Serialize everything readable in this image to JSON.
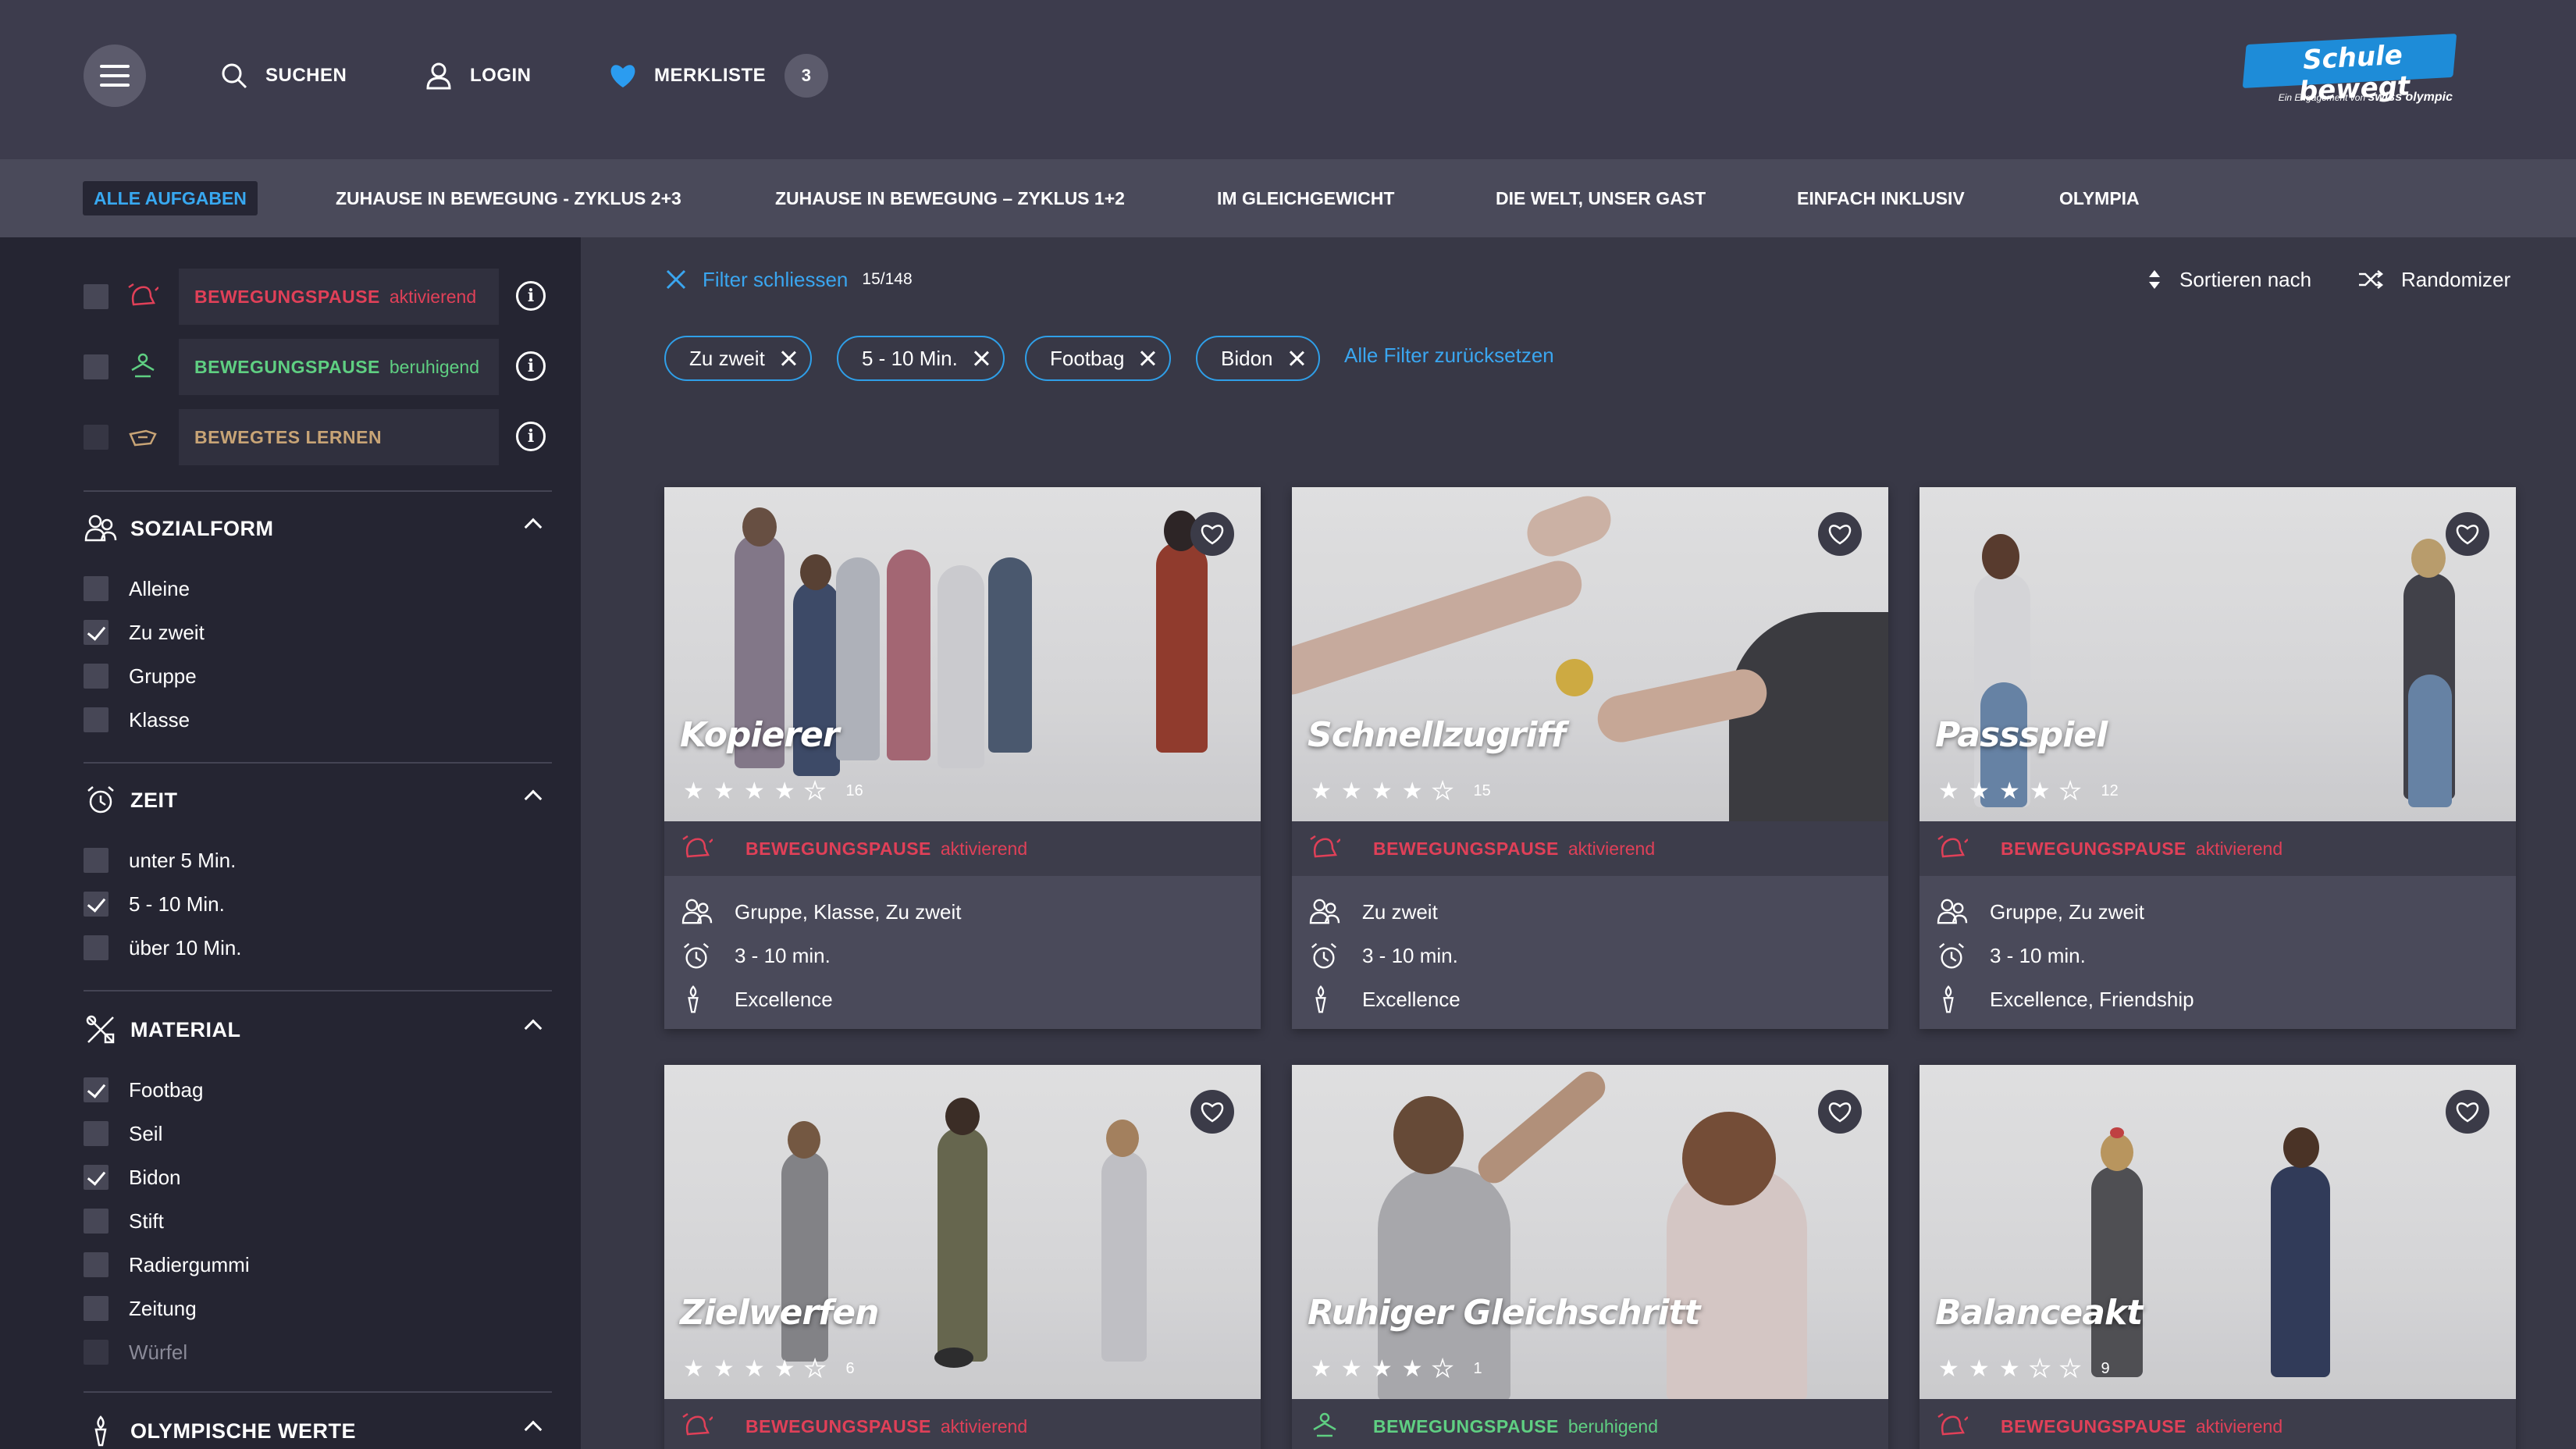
{
  "header": {
    "search_label": "SUCHEN",
    "login_label": "LOGIN",
    "watchlist_label": "MERKLISTE",
    "watchlist_count": "3",
    "logo_main": "Schule bewegt",
    "logo_sub_prefix": "Ein Engagement von",
    "logo_sub_brand": "swiss olympic"
  },
  "categories": [
    "ALLE AUFGABEN",
    "ZUHAUSE IN BEWEGUNG - ZYKLUS 2+3",
    "ZUHAUSE IN BEWEGUNG – ZYKLUS 1+2",
    "IM GLEICHGEWICHT",
    "DIE WELT, UNSER GAST",
    "EINFACH INKLUSIV",
    "OLYMPIA"
  ],
  "sidebar": {
    "types": [
      {
        "main": "BEWEGUNGSPAUSE",
        "sub": "aktivierend",
        "color": "#e04058"
      },
      {
        "main": "BEWEGUNGSPAUSE",
        "sub": "beruhigend",
        "color": "#5fcf82"
      },
      {
        "main": "BEWEGTES LERNEN",
        "sub": "",
        "color": "#c8a476"
      }
    ],
    "sozialform": {
      "title": "SOZIALFORM",
      "options": [
        {
          "label": "Alleine",
          "checked": false
        },
        {
          "label": "Zu zweit",
          "checked": true
        },
        {
          "label": "Gruppe",
          "checked": false
        },
        {
          "label": "Klasse",
          "checked": false
        }
      ]
    },
    "zeit": {
      "title": "ZEIT",
      "options": [
        {
          "label": "unter 5 Min.",
          "checked": false
        },
        {
          "label": "5 - 10 Min.",
          "checked": true
        },
        {
          "label": "über 10 Min.",
          "checked": false
        }
      ]
    },
    "material": {
      "title": "MATERIAL",
      "options": [
        {
          "label": "Footbag",
          "checked": true
        },
        {
          "label": "Seil",
          "checked": false
        },
        {
          "label": "Bidon",
          "checked": true
        },
        {
          "label": "Stift",
          "checked": false
        },
        {
          "label": "Radiergummi",
          "checked": false
        },
        {
          "label": "Zeitung",
          "checked": false
        },
        {
          "label": "Würfel",
          "checked": false
        }
      ]
    },
    "olympic_values": {
      "title": "OLYMPISCHE WERTE"
    }
  },
  "filterbar": {
    "close_label": "Filter schliessen",
    "count": "15/148",
    "sort_label": "Sortieren nach",
    "random_label": "Randomizer",
    "chips": [
      "Zu zweit",
      "5 - 10 Min.",
      "Footbag",
      "Bidon"
    ],
    "reset_label": "Alle Filter zurücksetzen"
  },
  "cards": [
    {
      "title": "Kopierer",
      "rating": 4,
      "votes": "16",
      "type_main": "BEWEGUNGSPAUSE",
      "type_sub": "aktivierend",
      "type_color": "#e04058",
      "social": "Gruppe, Klasse, Zu zweit",
      "time": "3 - 10 min.",
      "values": "Excellence"
    },
    {
      "title": "Schnellzugriff",
      "rating": 4,
      "votes": "15",
      "type_main": "BEWEGUNGSPAUSE",
      "type_sub": "aktivierend",
      "type_color": "#e04058",
      "social": "Zu zweit",
      "time": "3 - 10 min.",
      "values": "Excellence"
    },
    {
      "title": "Passspiel",
      "rating": 4,
      "votes": "12",
      "type_main": "BEWEGUNGSPAUSE",
      "type_sub": "aktivierend",
      "type_color": "#e04058",
      "social": "Gruppe, Zu zweit",
      "time": "3 - 10 min.",
      "values": "Excellence, Friendship"
    },
    {
      "title": "Zielwerfen",
      "rating": 4,
      "votes": "6",
      "type_main": "BEWEGUNGSPAUSE",
      "type_sub": "aktivierend",
      "type_color": "#e04058"
    },
    {
      "title": "Ruhiger Gleichschritt",
      "rating": 4,
      "votes": "1",
      "type_main": "BEWEGUNGSPAUSE",
      "type_sub": "beruhigend",
      "type_color": "#5fcf82"
    },
    {
      "title": "Balanceakt",
      "rating": 3,
      "votes": "9",
      "type_main": "BEWEGUNGSPAUSE",
      "type_sub": "aktivierend",
      "type_color": "#e04058"
    }
  ]
}
